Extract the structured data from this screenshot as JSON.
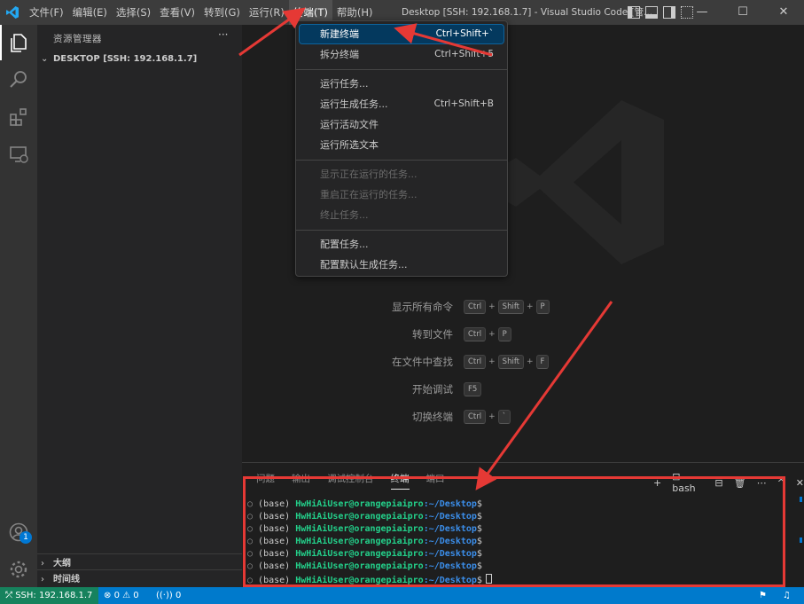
{
  "titlebar": {
    "menu": [
      "文件(F)",
      "编辑(E)",
      "选择(S)",
      "查看(V)",
      "转到(G)",
      "运行(R)",
      "终端(T)",
      "帮助(H)"
    ],
    "window_title": "Desktop [SSH: 192.168.1.7] - Visual Studio Code [管...",
    "minimize": "—",
    "maximize": "☐",
    "close": "✕"
  },
  "sidebar": {
    "title": "资源管理器",
    "more": "···",
    "folder": "DESKTOP [SSH: 192.168.1.7]",
    "outline": "大纲",
    "timeline": "时间线"
  },
  "activitybar": {
    "icons": [
      "explorer-icon",
      "search-icon",
      "extensions-icon",
      "remote-explorer-icon",
      "account-icon",
      "settings-gear-icon"
    ],
    "badge": "1"
  },
  "terminal_menu": {
    "groups": [
      [
        {
          "label": "新建终端",
          "shortcut": "Ctrl+Shift+`",
          "disabled": false
        },
        {
          "label": "拆分终端",
          "shortcut": "Ctrl+Shift+5",
          "disabled": false
        }
      ],
      [
        {
          "label": "运行任务...",
          "shortcut": "",
          "disabled": false
        },
        {
          "label": "运行生成任务...",
          "shortcut": "Ctrl+Shift+B",
          "disabled": false
        },
        {
          "label": "运行活动文件",
          "shortcut": "",
          "disabled": false
        },
        {
          "label": "运行所选文本",
          "shortcut": "",
          "disabled": false
        }
      ],
      [
        {
          "label": "显示正在运行的任务...",
          "shortcut": "",
          "disabled": true
        },
        {
          "label": "重启正在运行的任务...",
          "shortcut": "",
          "disabled": true
        },
        {
          "label": "终止任务...",
          "shortcut": "",
          "disabled": true
        }
      ],
      [
        {
          "label": "配置任务...",
          "shortcut": "",
          "disabled": false
        },
        {
          "label": "配置默认生成任务...",
          "shortcut": "",
          "disabled": false
        }
      ]
    ]
  },
  "welcome_shortcuts": [
    {
      "label": "显示所有命令",
      "keys": [
        "Ctrl",
        "Shift",
        "P"
      ]
    },
    {
      "label": "转到文件",
      "keys": [
        "Ctrl",
        "P"
      ]
    },
    {
      "label": "在文件中查找",
      "keys": [
        "Ctrl",
        "Shift",
        "F"
      ]
    },
    {
      "label": "开始调试",
      "keys": [
        "F5"
      ]
    },
    {
      "label": "切换终端",
      "keys": [
        "Ctrl",
        "`"
      ]
    }
  ],
  "panel": {
    "tabs": [
      "问题",
      "输出",
      "调试控制台",
      "终端",
      "端口"
    ],
    "active_tab": "终端",
    "terminal_name": "bash",
    "actions": [
      "+",
      "⌄",
      "⊟",
      "🗑",
      "⋯",
      "^",
      "✕"
    ]
  },
  "terminal": {
    "env": "(base)",
    "user_host": "HwHiAiUser@orangepiaipro",
    "path": ":~/Desktop",
    "prompt": "$",
    "line_count": 7
  },
  "statusbar": {
    "remote": "SSH: 192.168.1.7",
    "errors": "0",
    "warnings": "0",
    "ports": "0"
  },
  "colors": {
    "accent": "#007acc",
    "remote": "#16825d",
    "annotation": "#e53935",
    "menu_highlight": "#04395e"
  }
}
